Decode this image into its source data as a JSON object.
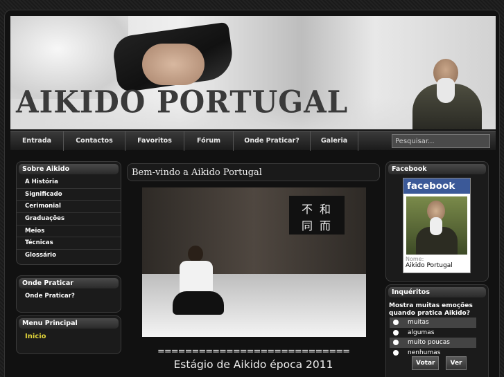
{
  "banner": {
    "title": "AIKIDO PORTUGAL"
  },
  "nav": {
    "items": [
      {
        "label": "Entrada"
      },
      {
        "label": "Contactos"
      },
      {
        "label": "Favoritos"
      },
      {
        "label": "Fórum"
      },
      {
        "label": "Onde Praticar?"
      },
      {
        "label": "Galeria"
      }
    ],
    "search_placeholder": "Pesquisar..."
  },
  "left": {
    "sobre": {
      "title": "Sobre Aikido",
      "items": [
        "A História",
        "Significado",
        "Cerimonial",
        "Graduações",
        "Meios",
        "Técnicas",
        "Glossário"
      ]
    },
    "onde": {
      "title": "Onde Praticar",
      "items": [
        "Onde Praticar?"
      ]
    },
    "menu": {
      "title": "Menu Principal",
      "items": [
        "Inicio"
      ]
    }
  },
  "content": {
    "welcome": "Bem-vindo a Aikido Portugal",
    "separator": "============================",
    "event_title": "Estágio de Aikido época 2011",
    "scroll_chars": [
      "和",
      "而",
      "不",
      "同"
    ]
  },
  "right": {
    "facebook": {
      "title": "Facebook",
      "logo": "facebook",
      "name_label": "Nome:",
      "name": "Aikido Portugal"
    },
    "poll": {
      "title": "Inquéritos",
      "question": "Mostra muitas emoções quando pratica Aikido?",
      "options": [
        "muitas",
        "algumas",
        "muito poucas",
        "nenhumas"
      ],
      "vote_label": "Votar",
      "view_label": "Ver"
    }
  }
}
